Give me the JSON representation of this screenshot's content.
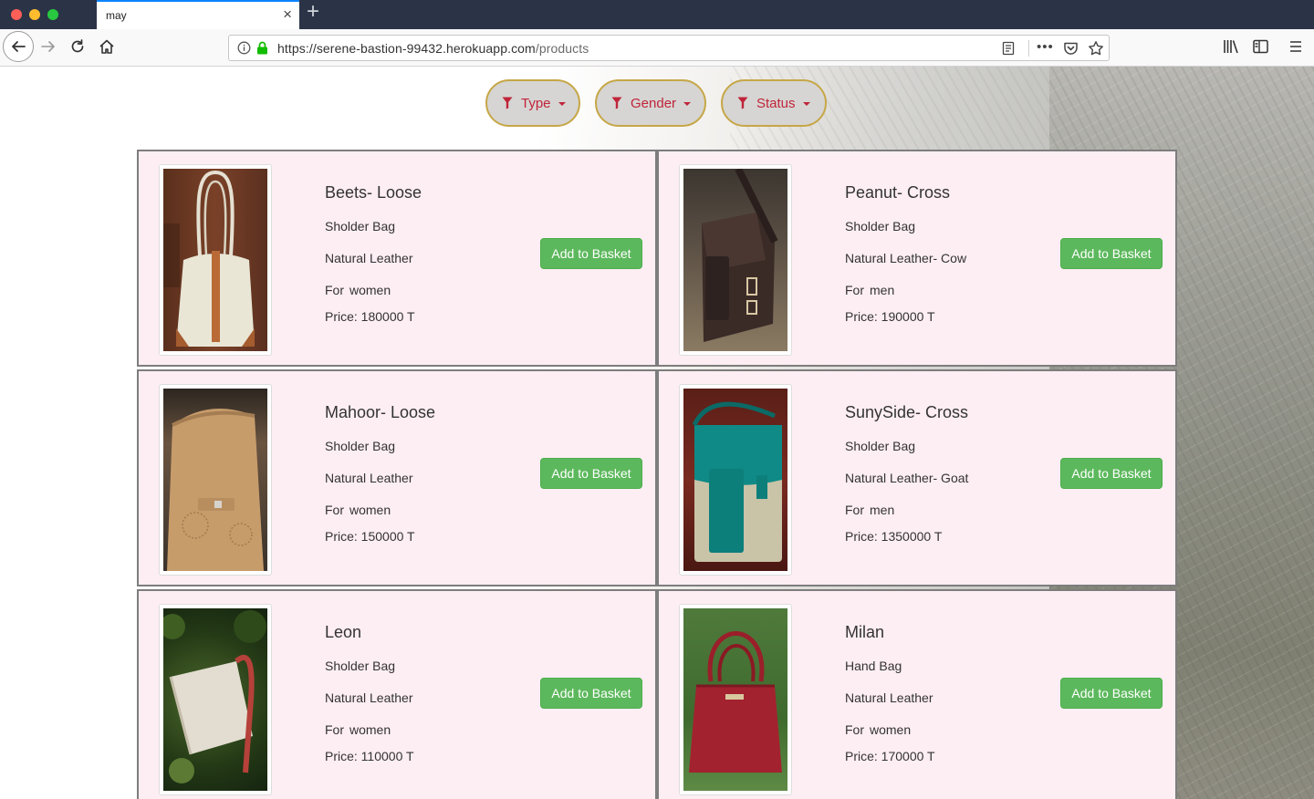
{
  "browser": {
    "tab_title": "may",
    "tab_close": "×",
    "new_tab": "+",
    "url_base": "https://serene-bastion-99432.herokuapp.com",
    "url_path": "/products",
    "more_dots": "•••"
  },
  "filters": [
    {
      "label": "Type"
    },
    {
      "label": "Gender"
    },
    {
      "label": "Status"
    }
  ],
  "accent_colors": {
    "add_button": "#5cb85c",
    "filter_text": "#c0243a",
    "filter_border": "#c6a747",
    "card_bg": "#fdeef3"
  },
  "products": [
    {
      "name": "Beets- Loose",
      "style": "Sholder Bag",
      "material": "Natural Leather",
      "for_label": "For",
      "for_value": "women",
      "price": "Price: 180000 T",
      "button": "Add to Basket"
    },
    {
      "name": "Peanut- Cross",
      "style": "Sholder Bag",
      "material": "Natural Leather- Cow",
      "for_label": "For",
      "for_value": "men",
      "price": "Price: 190000 T",
      "button": "Add to Basket"
    },
    {
      "name": "Mahoor- Loose",
      "style": "Sholder Bag",
      "material": "Natural Leather",
      "for_label": "For",
      "for_value": "women",
      "price": "Price: 150000 T",
      "button": "Add to Basket"
    },
    {
      "name": "SunySide- Cross",
      "style": "Sholder Bag",
      "material": "Natural Leather- Goat",
      "for_label": "For",
      "for_value": "men",
      "price": "Price: 1350000 T",
      "button": "Add to Basket"
    },
    {
      "name": "Leon",
      "style": "Sholder Bag",
      "material": "Natural Leather",
      "for_label": "For",
      "for_value": "women",
      "price": "Price: 110000 T",
      "button": "Add to Basket"
    },
    {
      "name": "Milan",
      "style": "Hand Bag",
      "material": "Natural Leather",
      "for_label": "For",
      "for_value": "women",
      "price": "Price: 170000 T",
      "button": "Add to Basket"
    }
  ]
}
